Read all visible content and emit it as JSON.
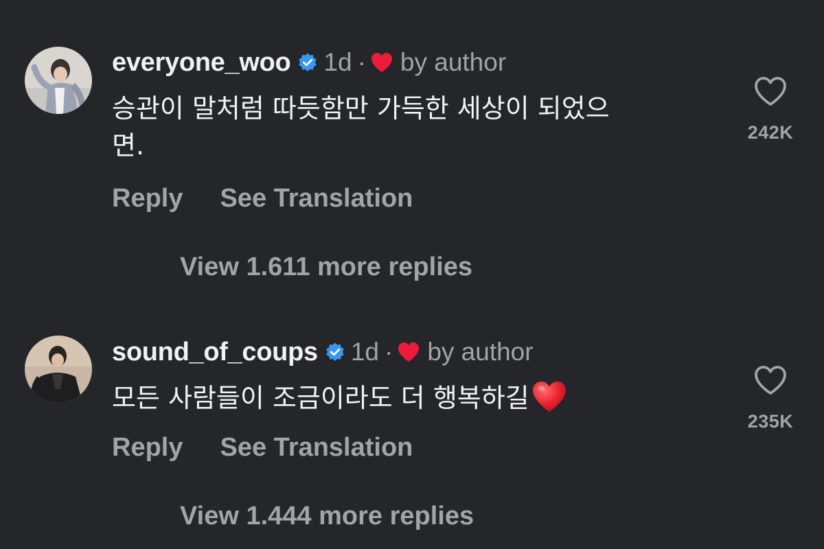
{
  "colors": {
    "background": "#25262a",
    "primary_text": "#f2f2f2",
    "secondary_text": "#a3a4a8",
    "verified_blue": "#3897f0",
    "heart_red": "#ed1c3a"
  },
  "comments": [
    {
      "username": "everyone_woo",
      "verified": true,
      "time": "1d",
      "separator": "·",
      "liked_by_author_icon": "heart-icon",
      "liked_by_author_label": "by author",
      "text_line1": "승관이 말처럼 따듯함만 가득한 세상이 되었으",
      "text_line2": "면.",
      "reply_label": "Reply",
      "translate_label": "See Translation",
      "like_icon": "heart-outline-icon",
      "like_count": "242K",
      "view_replies_label": "View 1.611 more replies"
    },
    {
      "username": "sound_of_coups",
      "verified": true,
      "time": "1d",
      "separator": "·",
      "liked_by_author_icon": "heart-icon",
      "liked_by_author_label": "by author",
      "text_line1": "모든 사람들이 조금이라도 더 행복하길",
      "text_emoji": "red-heart-emoji",
      "reply_label": "Reply",
      "translate_label": "See Translation",
      "like_icon": "heart-outline-icon",
      "like_count": "235K",
      "view_replies_label": "View 1.444 more replies"
    }
  ]
}
